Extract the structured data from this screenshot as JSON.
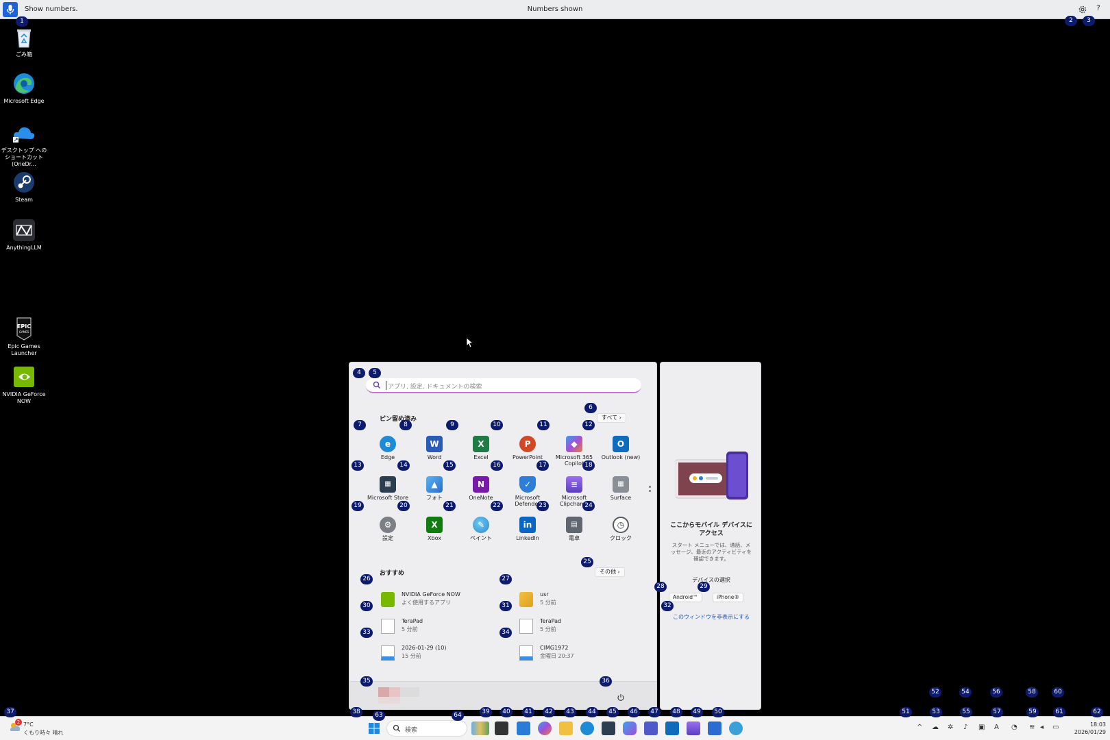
{
  "voice_bar": {
    "listening_text": "Show numbers.",
    "status_text": "Numbers shown",
    "help_label": "?"
  },
  "desktop_icons": [
    {
      "label": "ごみ箱",
      "icon": "recycle-bin-icon"
    },
    {
      "label": "Microsoft Edge",
      "icon": "edge-icon"
    },
    {
      "label": "デスクトップ へのショートカット (OneDr...",
      "icon": "onedrive-icon"
    },
    {
      "label": "Steam",
      "icon": "steam-icon"
    },
    {
      "label": "AnythingLLM",
      "icon": "anythingllm-icon"
    },
    {
      "label": "Epic Games Launcher",
      "icon": "epic-games-icon"
    },
    {
      "label": "NVIDIA GeForce NOW",
      "icon": "nvidia-icon"
    }
  ],
  "start_menu": {
    "search_placeholder": "アプリ, 設定, ドキュメントの検索",
    "pinned_title": "ピン留め済み",
    "all_button": "すべて ›",
    "pinned_apps": [
      {
        "label": "Edge",
        "icon": "edge-icon",
        "color": "#1d8bd6"
      },
      {
        "label": "Word",
        "icon": "word-icon",
        "color": "#2b5bb8"
      },
      {
        "label": "Excel",
        "icon": "excel-icon",
        "color": "#1f7a45"
      },
      {
        "label": "PowerPoint",
        "icon": "powerpoint-icon",
        "color": "#d24726"
      },
      {
        "label": "Microsoft 365 Copilot",
        "icon": "copilot-icon",
        "color": "#8a5bd6"
      },
      {
        "label": "Outlook (new)",
        "icon": "outlook-icon",
        "color": "#0f6cbd"
      },
      {
        "label": "Microsoft Store",
        "icon": "store-icon",
        "color": "#2d3e50"
      },
      {
        "label": "フォト",
        "icon": "photos-icon",
        "color": "#3a8ee6"
      },
      {
        "label": "OneNote",
        "icon": "onenote-icon",
        "color": "#7719aa"
      },
      {
        "label": "Microsoft Defender",
        "icon": "defender-icon",
        "color": "#2e7dd6"
      },
      {
        "label": "Microsoft Clipchamp",
        "icon": "clipchamp-icon",
        "color": "#7b4fd8"
      },
      {
        "label": "Surface",
        "icon": "surface-icon",
        "color": "#8a8f96"
      },
      {
        "label": "設定",
        "icon": "settings-icon",
        "color": "#7b7f86"
      },
      {
        "label": "Xbox",
        "icon": "xbox-icon",
        "color": "#107c10"
      },
      {
        "label": "ペイント",
        "icon": "paint-icon",
        "color": "#3aa0d8"
      },
      {
        "label": "LinkedIn",
        "icon": "linkedin-icon",
        "color": "#0a66c2"
      },
      {
        "label": "電卓",
        "icon": "calculator-icon",
        "color": "#5f6670"
      },
      {
        "label": "クロック",
        "icon": "clock-icon",
        "color": "#555a61"
      }
    ],
    "recommended_title": "おすすめ",
    "more_button": "その他 ›",
    "recommended": [
      {
        "title": "NVIDIA GeForce NOW",
        "subtitle": "よく使用するアプリ",
        "icon": "nvidia-icon"
      },
      {
        "title": "usr",
        "subtitle": "5 分前",
        "icon": "folder-user-icon"
      },
      {
        "title": "TeraPad",
        "subtitle": "5 分前",
        "icon": "text-file-icon"
      },
      {
        "title": "TeraPad",
        "subtitle": "5 分前",
        "icon": "text-file-icon"
      },
      {
        "title": "2026-01-29 (10)",
        "subtitle": "15 分前",
        "icon": "image-file-icon"
      },
      {
        "title": "CIMG1972",
        "subtitle": "金曜日 20:37",
        "icon": "image-file-icon"
      }
    ]
  },
  "phone_panel": {
    "title": "ここからモバイル デバイスにアクセス",
    "description": "スタート メニューでは、通話、メッセージ、最近のアクティビティを確認できます。",
    "select_label": "デバイスの選択",
    "android_button": "Android™",
    "iphone_button": "iPhone®",
    "hide_link": "このウィンドウを非表示にする"
  },
  "taskbar": {
    "weather_temp": "7°C",
    "weather_desc": "くもり時々 晴れ",
    "weather_alert_count": "2",
    "search_placeholder": "検索",
    "time": "18:03",
    "date": "2026/01/29"
  },
  "badges": [
    "1",
    "2",
    "3",
    "4",
    "5",
    "6",
    "7",
    "8",
    "9",
    "10",
    "11",
    "12",
    "13",
    "14",
    "15",
    "16",
    "17",
    "18",
    "19",
    "20",
    "21",
    "22",
    "23",
    "24",
    "25",
    "26",
    "27",
    "28",
    "29",
    "30",
    "31",
    "32",
    "33",
    "34",
    "35",
    "36",
    "37",
    "38",
    "39",
    "40",
    "41",
    "42",
    "43",
    "44",
    "45",
    "46",
    "47",
    "48",
    "49",
    "50",
    "51",
    "52",
    "53",
    "54",
    "55",
    "56",
    "57",
    "58",
    "59",
    "60",
    "61",
    "62",
    "63",
    "64"
  ]
}
